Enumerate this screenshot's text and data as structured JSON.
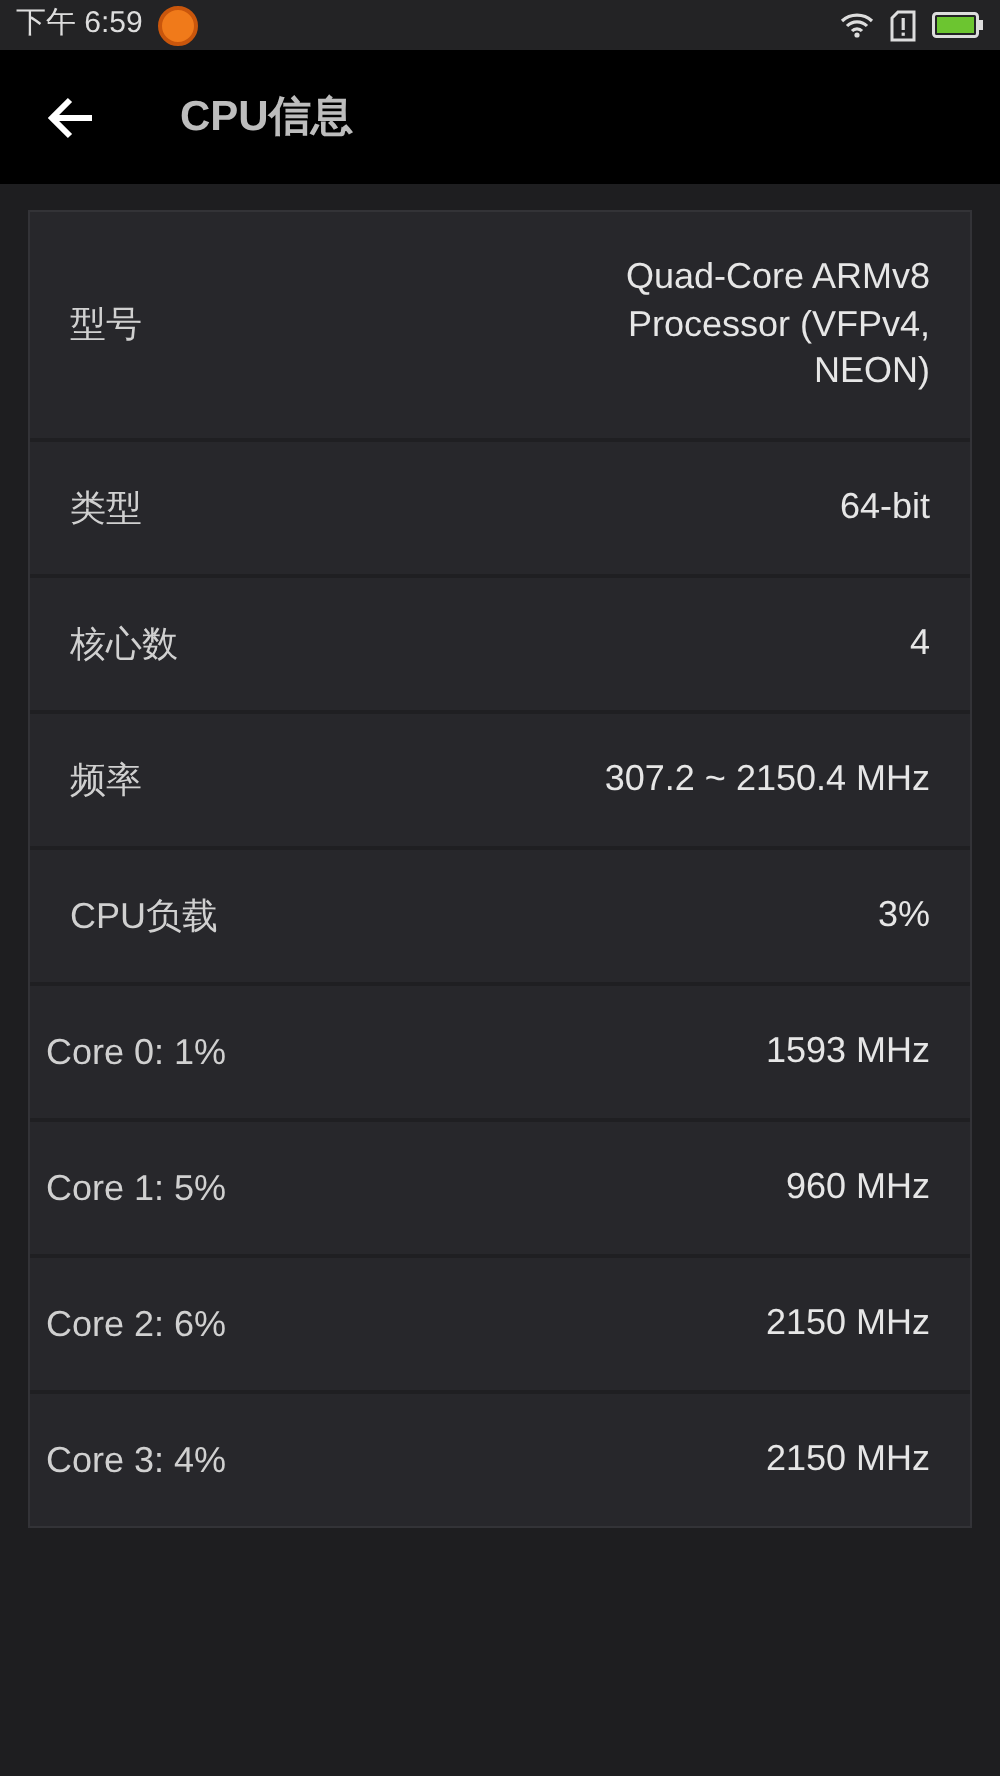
{
  "status_bar": {
    "time": "下午 6:59"
  },
  "app_bar": {
    "title": "CPU信息"
  },
  "rows": [
    {
      "kind": "info",
      "label": "型号",
      "value": "Quad-Core ARMv8 Processor (VFPv4, NEON)"
    },
    {
      "kind": "info",
      "label": "类型",
      "value": "64-bit"
    },
    {
      "kind": "info",
      "label": "核心数",
      "value": "4"
    },
    {
      "kind": "info",
      "label": "频率",
      "value": "307.2 ~ 2150.4 MHz"
    },
    {
      "kind": "info",
      "label": "CPU负载",
      "value": "3%"
    },
    {
      "kind": "core",
      "label": "Core 0: 1%",
      "value": "1593 MHz"
    },
    {
      "kind": "core",
      "label": "Core 1: 5%",
      "value": "960 MHz"
    },
    {
      "kind": "core",
      "label": "Core 2: 6%",
      "value": "2150 MHz"
    },
    {
      "kind": "core",
      "label": "Core 3: 4%",
      "value": "2150 MHz"
    }
  ]
}
